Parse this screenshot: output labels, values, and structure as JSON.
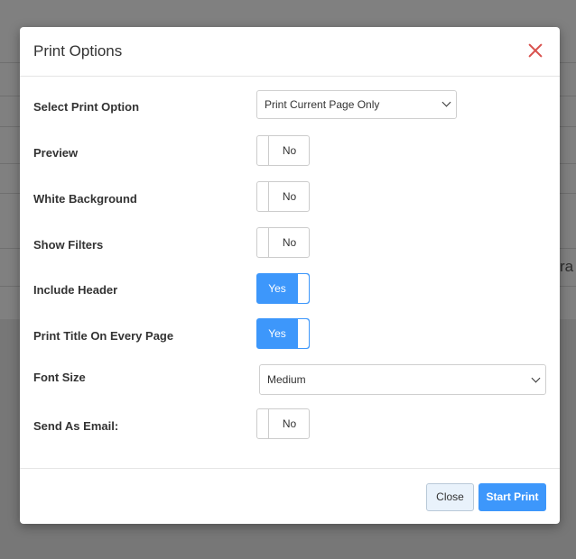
{
  "background": {
    "partial_text": "ra"
  },
  "modal": {
    "title": "Print Options",
    "rows": {
      "print_option": {
        "label": "Select Print Option",
        "selected": "Print Current Page Only"
      },
      "preview": {
        "label": "Preview",
        "value": "No",
        "on": false
      },
      "white_background": {
        "label": "White Background",
        "value": "No",
        "on": false
      },
      "show_filters": {
        "label": "Show Filters",
        "value": "No",
        "on": false
      },
      "include_header": {
        "label": "Include Header",
        "value": "Yes",
        "on": true
      },
      "print_title": {
        "label": "Print Title On Every Page",
        "value": "Yes",
        "on": true
      },
      "font_size": {
        "label": "Font Size",
        "selected": "Medium"
      },
      "send_email": {
        "label": "Send As Email:",
        "value": "No",
        "on": false
      }
    },
    "footer": {
      "close_label": "Close",
      "start_label": "Start Print"
    }
  },
  "colors": {
    "accent": "#3d97fb",
    "close_icon": "#d9534f",
    "backdrop": "#7a7a7a"
  },
  "icons": [
    "close-icon",
    "chevron-down-icon"
  ]
}
